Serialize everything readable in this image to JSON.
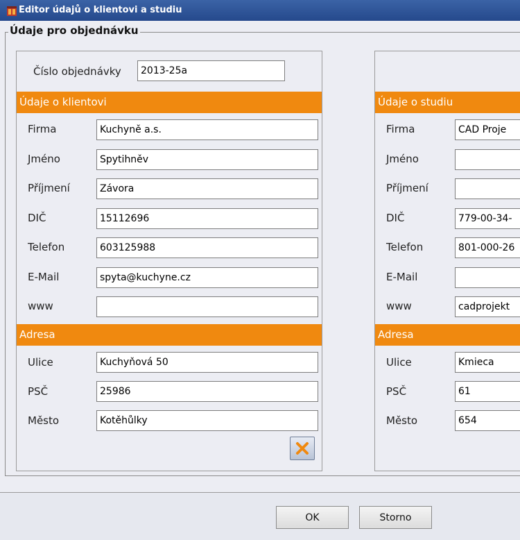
{
  "window": {
    "title": "Editor údajů o klientovi a studiu"
  },
  "group": {
    "title": "Údaje pro objednávku"
  },
  "order": {
    "label": "Číslo objednávky",
    "value": "2013-25a"
  },
  "client": {
    "header": "Údaje o klientovi",
    "fields": [
      {
        "label": "Firma",
        "value": "Kuchyně a.s."
      },
      {
        "label": "Jméno",
        "value": "Spytihněv"
      },
      {
        "label": "Příjmení",
        "value": "Závora"
      },
      {
        "label": "DIČ",
        "value": "15112696"
      },
      {
        "label": "Telefon",
        "value": "603125988"
      },
      {
        "label": "E-Mail",
        "value": "spyta@kuchyne.cz"
      },
      {
        "label": "www",
        "value": ""
      }
    ],
    "address_header": "Adresa",
    "address": [
      {
        "label": "Ulice",
        "value": "Kuchyňová 50"
      },
      {
        "label": "PSČ",
        "value": "25986"
      },
      {
        "label": "Město",
        "value": "Kotěhůlky"
      }
    ]
  },
  "studio": {
    "header": "Údaje o studiu",
    "fields": [
      {
        "label": "Firma",
        "value": "CAD Proje"
      },
      {
        "label": "Jméno",
        "value": ""
      },
      {
        "label": "Příjmení",
        "value": ""
      },
      {
        "label": "DIČ",
        "value": "779-00-34-"
      },
      {
        "label": "Telefon",
        "value": "801-000-26"
      },
      {
        "label": "E-Mail",
        "value": ""
      },
      {
        "label": "www",
        "value": "cadprojekt"
      }
    ],
    "address_header": "Adresa",
    "address": [
      {
        "label": "Ulice",
        "value": "Kmieca"
      },
      {
        "label": "PSČ",
        "value": "61"
      },
      {
        "label": "Město",
        "value": "654"
      }
    ]
  },
  "buttons": {
    "ok": "OK",
    "cancel": "Storno"
  },
  "icons": {
    "app": "app-icon",
    "clear": "clear-x-icon"
  },
  "colors": {
    "accent": "#f0890f",
    "titlebar": "#2f559a",
    "clear_x": "#f0890f"
  }
}
